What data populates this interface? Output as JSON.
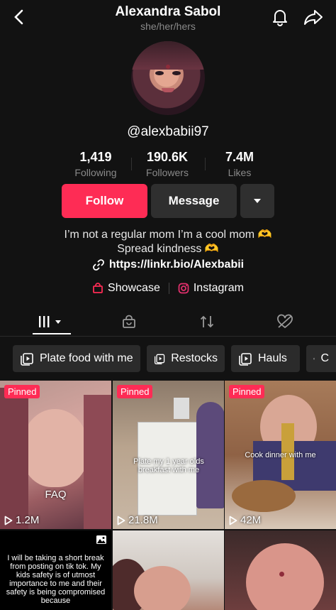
{
  "header": {
    "name": "Alexandra Sabol",
    "pronouns": "she/her/hers",
    "back_icon": "chevron-left-icon",
    "bell_icon": "bell-icon",
    "share_icon": "share-icon"
  },
  "profile": {
    "handle": "@alexbabii97",
    "stats": [
      {
        "value": "1,419",
        "label": "Following"
      },
      {
        "value": "190.6K",
        "label": "Followers"
      },
      {
        "value": "7.4M",
        "label": "Likes"
      }
    ],
    "follow_label": "Follow",
    "message_label": "Message",
    "bio_line1": "I’m not a regular mom I’m a cool mom 🫶",
    "bio_line2": "Spread kindness 🫶",
    "link": "https://linkr.bio/Alexbabii",
    "showcase_label": "Showcase",
    "instagram_label": "Instagram"
  },
  "tabs": [
    "videos-grid",
    "shop",
    "reposts",
    "liked-hidden"
  ],
  "chips": [
    "Plate food with me",
    "Restocks",
    "Hauls",
    "C"
  ],
  "videos": [
    {
      "pinned": "Pinned",
      "views": "1.2M",
      "overlay": "FAQ"
    },
    {
      "pinned": "Pinned",
      "views": "21.8M",
      "overlay": "Plate my 1 year olds breakfast with me"
    },
    {
      "pinned": "Pinned",
      "views": "42M",
      "overlay": "Cook dinner with me"
    },
    {
      "overlay": "I will be taking a short break from posting on tik tok. My kids safety is of utmost importance to me and their safety is being compromised because"
    },
    {},
    {}
  ],
  "colors": {
    "accent": "#fe2c55",
    "background": "#121212",
    "button_dark": "#2f2f2f"
  }
}
